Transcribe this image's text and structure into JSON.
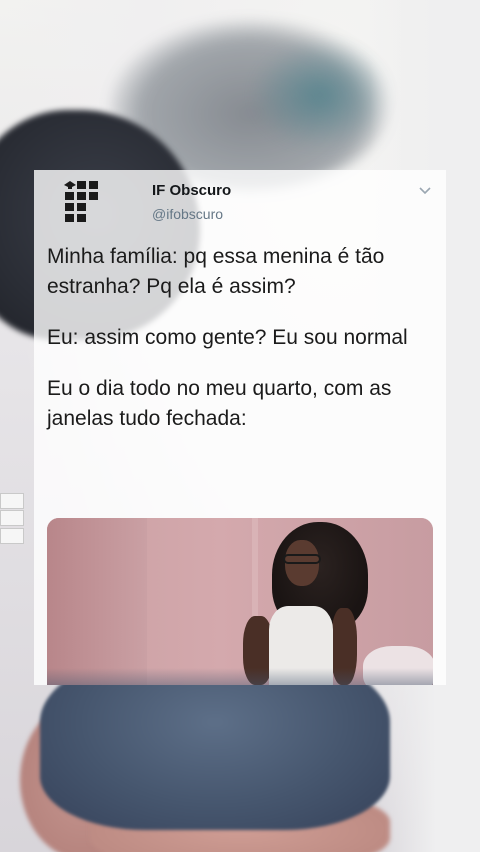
{
  "tweet": {
    "display_name": "IF Obscuro",
    "handle": "@ifobscuro",
    "logo_icon": "if-institute-logo",
    "menu_icon": "chevron-down-icon",
    "paragraphs": [
      "Minha família: pq essa menina é tão estranha? Pq ela é assim?",
      "Eu: assim como gente? Eu sou normal",
      "Eu o dia todo no meu quarto, com as janelas tudo fechada:"
    ],
    "media_description_icon": "photo-thumbnail"
  },
  "colors": {
    "name_text": "#14171a",
    "handle_text": "#657786",
    "logo_green": "#2f9e41",
    "logo_red": "#c8191e",
    "logo_black": "#1a1a1a"
  }
}
